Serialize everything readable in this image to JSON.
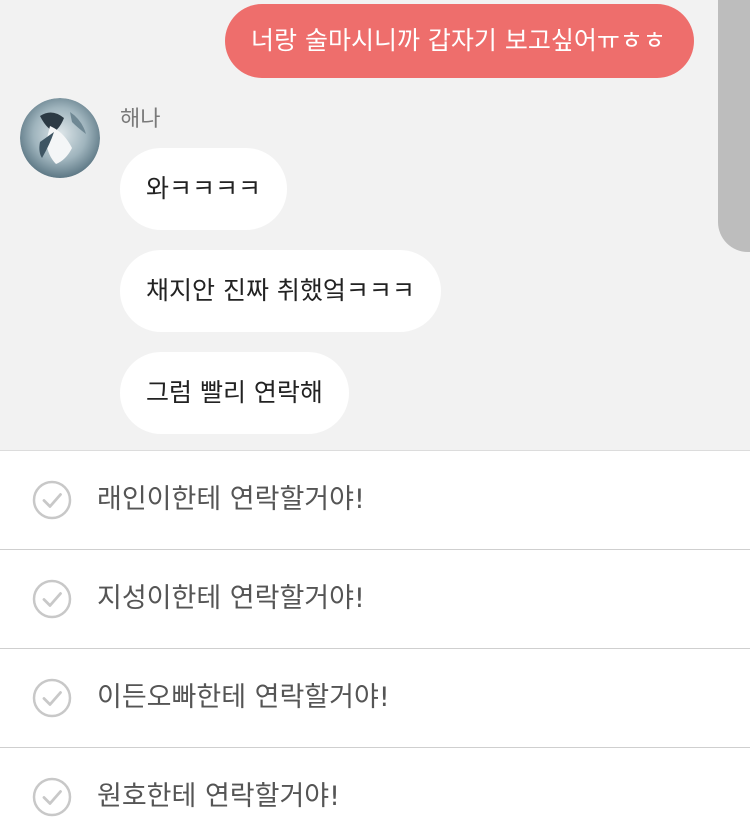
{
  "chat": {
    "sent_message": "너랑 술마시니까 갑자기 보고싶어ㅠㅎㅎ",
    "sender_name": "해나",
    "received_messages": [
      "와ㅋㅋㅋㅋ",
      "채지안 진짜 취했엌ㅋㅋㅋ",
      "그럼 빨리 연락해"
    ],
    "colors": {
      "sent_bubble": "#ee6e6c",
      "received_bubble": "#ffffff",
      "background": "#f2f2f2"
    }
  },
  "choices": [
    {
      "label": "래인이한테 연락할거야!",
      "icon": "check-circle-icon"
    },
    {
      "label": "지성이한테 연락할거야!",
      "icon": "check-circle-icon"
    },
    {
      "label": "이든오빠한테 연락할거야!",
      "icon": "check-circle-icon"
    },
    {
      "label": "원호한테 연락할거야!",
      "icon": "check-circle-icon"
    }
  ]
}
